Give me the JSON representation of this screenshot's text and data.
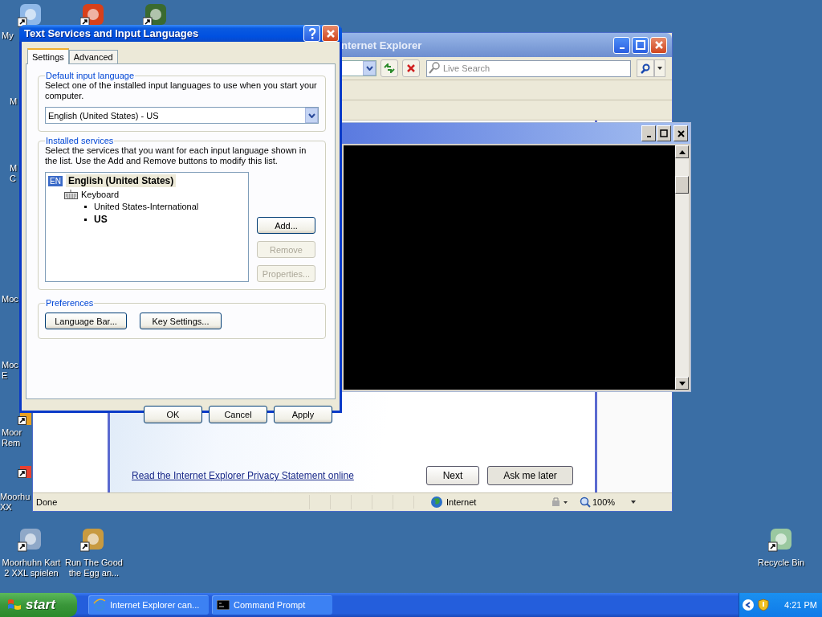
{
  "desktop_icons": [
    {
      "lines": [
        "My"
      ]
    },
    {
      "lines": [
        "M"
      ]
    },
    {
      "lines": [
        "M",
        "C"
      ]
    },
    {
      "lines": [
        "Moc"
      ]
    },
    {
      "lines": [
        "Moc",
        "E"
      ]
    },
    {
      "lines": [
        "Moor",
        "Rem"
      ]
    },
    {
      "lines": [
        "Moorhu",
        "XX"
      ]
    },
    {
      "lines": [
        "Moorhuhn Kart",
        "2 XXL spielen"
      ]
    },
    {
      "lines": [
        "Run The Good",
        "the Egg an..."
      ]
    },
    {
      "lines": [
        "Recycle Bin"
      ]
    }
  ],
  "browser": {
    "title": "nternet Explorer",
    "search": {
      "placeholder": "Live Search"
    },
    "link": "Read the Internet Explorer Privacy Statement online",
    "buttons": [
      "Next",
      "Ask me later"
    ],
    "status_bar": {
      "status": "Done",
      "zone": "Internet",
      "zoom": "100%"
    }
  },
  "dialog": {
    "title": "Text Services and Input Languages",
    "tabs": [
      {
        "label": "Settings",
        "selected": true
      },
      {
        "label": "Advanced",
        "selected": false
      }
    ],
    "default_language": {
      "legend": "Default input language",
      "description": "Select one of the installed input languages to use when you start your computer.",
      "value": "English (United States) - US"
    },
    "installed_services": {
      "legend": "Installed services",
      "description": "Select the services that you want for each input language shown in the list. Use the Add and Remove buttons to modify this list.",
      "tree": [
        {
          "badge": "EN",
          "label": "English (United States)",
          "selected": true,
          "children": [
            {
              "label": "Keyboard",
              "children": [
                {
                  "label": "United States-International",
                  "default": false
                },
                {
                  "label": "US",
                  "default": true
                }
              ]
            }
          ]
        }
      ],
      "buttons": [
        {
          "label": "Add...",
          "disabled": false
        },
        {
          "label": "Remove",
          "disabled": true
        },
        {
          "label": "Properties...",
          "disabled": true
        }
      ]
    },
    "preferences": {
      "legend": "Preferences",
      "buttons": [
        "Language Bar...",
        "Key Settings..."
      ]
    },
    "buttons": [
      "OK",
      "Cancel",
      "Apply"
    ]
  },
  "taskbar": {
    "start": "start",
    "tasks": [
      {
        "label": "Internet Explorer can..."
      },
      {
        "label": "Command Prompt"
      }
    ],
    "clock": "4:21 PM"
  }
}
